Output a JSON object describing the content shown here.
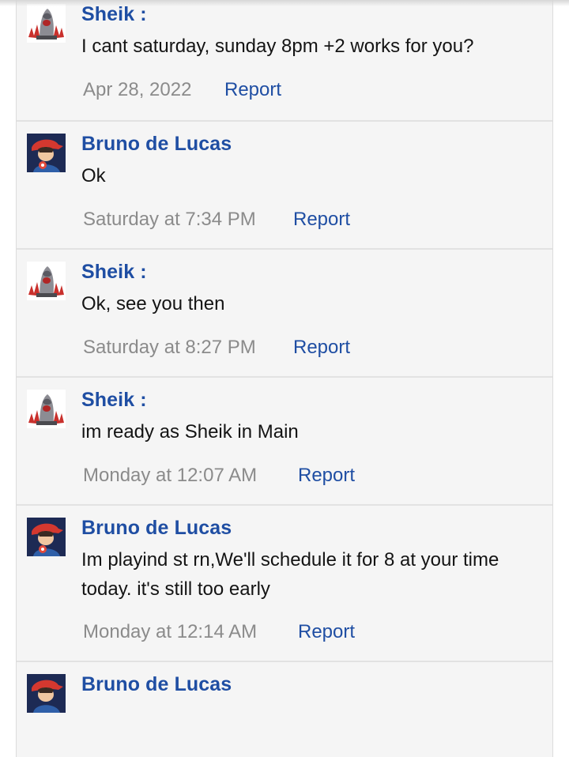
{
  "posts": [
    {
      "author": "Sheik :",
      "message": "I cant saturday, sunday 8pm +2 works for you?",
      "timestamp": "Apr 28, 2022",
      "report_label": "Report",
      "avatar_icon": "sheik-avatar-icon"
    },
    {
      "author": "Bruno de Lucas",
      "message": "Ok",
      "timestamp": "Saturday at 7:34 PM",
      "report_label": "Report",
      "avatar_icon": "bruno-avatar-icon"
    },
    {
      "author": "Sheik :",
      "message": "Ok, see you then",
      "timestamp": "Saturday at 8:27 PM",
      "report_label": "Report",
      "avatar_icon": "sheik-avatar-icon"
    },
    {
      "author": "Sheik :",
      "message": "im ready as Sheik in Main",
      "timestamp": "Monday at 12:07 AM",
      "report_label": "Report",
      "avatar_icon": "sheik-avatar-icon"
    },
    {
      "author": "Bruno de Lucas",
      "message": "Im playind st rn,We'll schedule it for 8 at your time today. it's still too early",
      "timestamp": "Monday at 12:14 AM",
      "report_label": "Report",
      "avatar_icon": "bruno-avatar-icon"
    },
    {
      "author": "Bruno de Lucas",
      "message": "",
      "timestamp": "",
      "report_label": "",
      "avatar_icon": "bruno-avatar-icon"
    }
  ],
  "colors": {
    "author_link": "#1f4ea3",
    "timestamp": "#8b8b8b",
    "background": "#f5f5f5",
    "divider": "#e2e2e2"
  }
}
